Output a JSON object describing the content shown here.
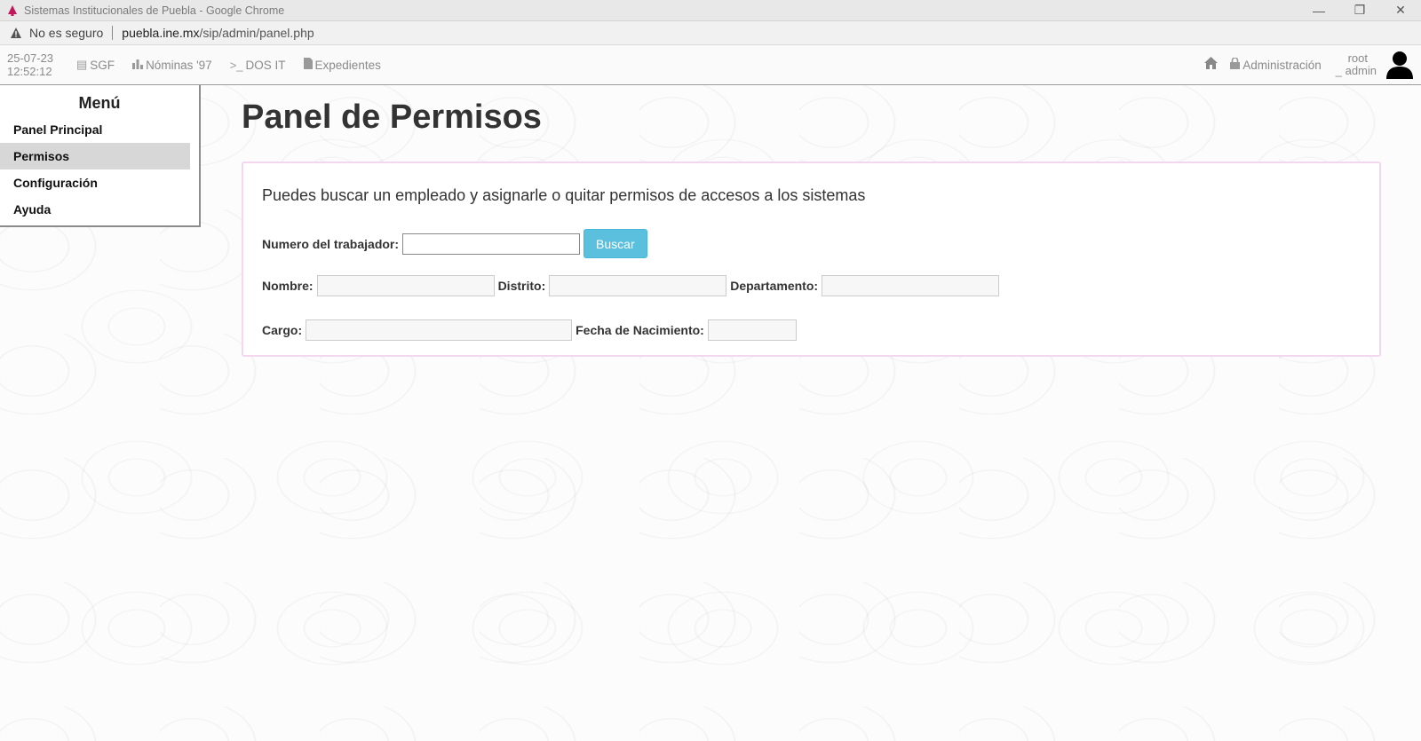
{
  "browser": {
    "window_title": "Sistemas Institucionales de Puebla - Google Chrome",
    "security_label": "No es seguro",
    "url_host": "puebla.ine.mx",
    "url_path": "/sip/admin/panel.php"
  },
  "topnav": {
    "date": "25-07-23",
    "time": "12:52:12",
    "links": [
      {
        "label": "SGF",
        "icon": "list-icon"
      },
      {
        "label": "Nóminas '97",
        "icon": "bar-chart-icon"
      },
      {
        "label": "DOS IT",
        "icon": "terminal-icon"
      },
      {
        "label": "Expedientes",
        "icon": "file-icon"
      }
    ],
    "admin_label": "Administración",
    "user_line1": "root",
    "user_line2": "_ admin"
  },
  "sidebar": {
    "title": "Menú",
    "items": [
      {
        "label": "Panel Principal",
        "active": false
      },
      {
        "label": "Permisos",
        "active": true
      },
      {
        "label": "Configuración",
        "active": false
      },
      {
        "label": "Ayuda",
        "active": false
      }
    ]
  },
  "main": {
    "title": "Panel de Permisos",
    "intro": "Puedes buscar un empleado y asignarle o quitar permisos de accesos a los sistemas",
    "worker_number_label": "Numero del trabajador:",
    "worker_number_value": "",
    "search_button": "Buscar",
    "nombre_label": "Nombre:",
    "distrito_label": "Distrito:",
    "departamento_label": "Departamento:",
    "cargo_label": "Cargo:",
    "fecha_label": "Fecha de Nacimiento:"
  },
  "colors": {
    "accent": "#5bc0de",
    "panel_border": "#f2d7ef",
    "active_menu": "#d7d7d7"
  }
}
